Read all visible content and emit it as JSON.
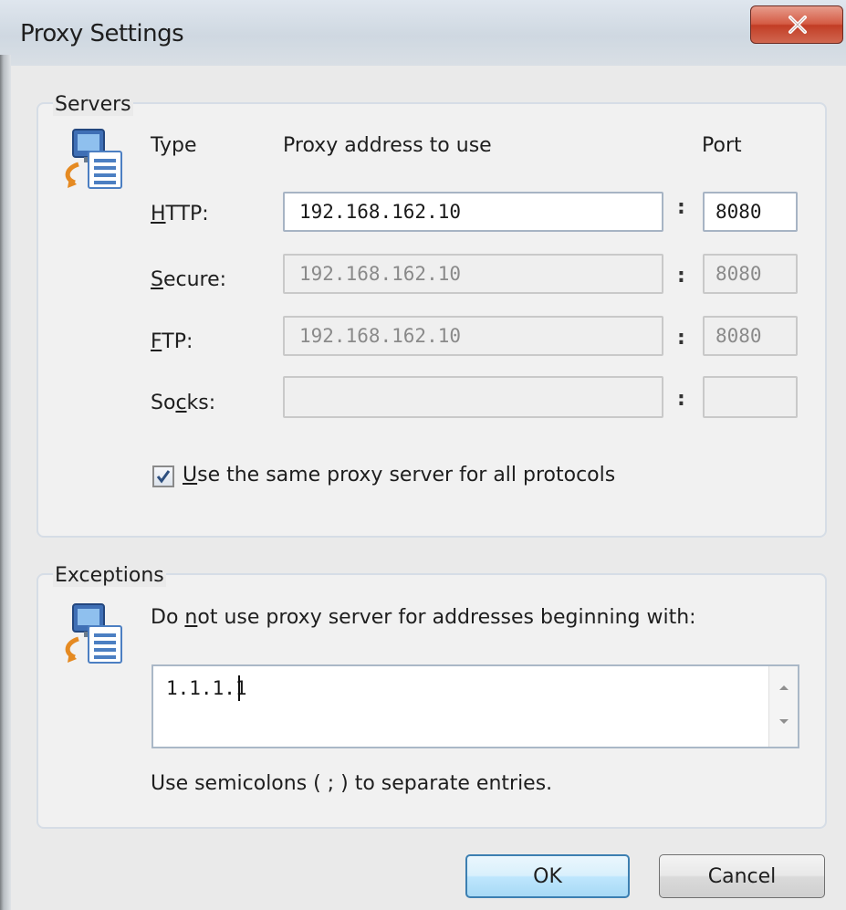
{
  "window": {
    "title": "Proxy Settings",
    "close_icon": "close-x-icon"
  },
  "servers": {
    "group_label": "Servers",
    "icon": "proxy-server-icon",
    "col_type": "Type",
    "col_address": "Proxy address to use",
    "col_port": "Port",
    "rows": [
      {
        "label_prefix": "",
        "label_ul": "H",
        "label_rest": "TTP:",
        "address": "192.168.162.10",
        "port": "8080",
        "enabled": true
      },
      {
        "label_prefix": "",
        "label_ul": "S",
        "label_rest": "ecure:",
        "address": "192.168.162.10",
        "port": "8080",
        "enabled": false
      },
      {
        "label_prefix": "",
        "label_ul": "F",
        "label_rest": "TP:",
        "address": "192.168.162.10",
        "port": "8080",
        "enabled": false
      },
      {
        "label_prefix": "So",
        "label_ul": "c",
        "label_rest": "ks:",
        "address": "",
        "port": "",
        "enabled": false
      }
    ],
    "colon": ":",
    "same_proxy": {
      "ul": "U",
      "rest": "se the same proxy server for all protocols",
      "checked": true
    }
  },
  "exceptions": {
    "group_label": "Exceptions",
    "icon": "proxy-exceptions-icon",
    "instr_prefix": "Do ",
    "instr_ul": "n",
    "instr_rest": "ot use proxy server for addresses beginning with:",
    "value": "1.1.1.1",
    "hint": "Use semicolons ( ; ) to separate entries."
  },
  "buttons": {
    "ok": "OK",
    "cancel": "Cancel"
  }
}
